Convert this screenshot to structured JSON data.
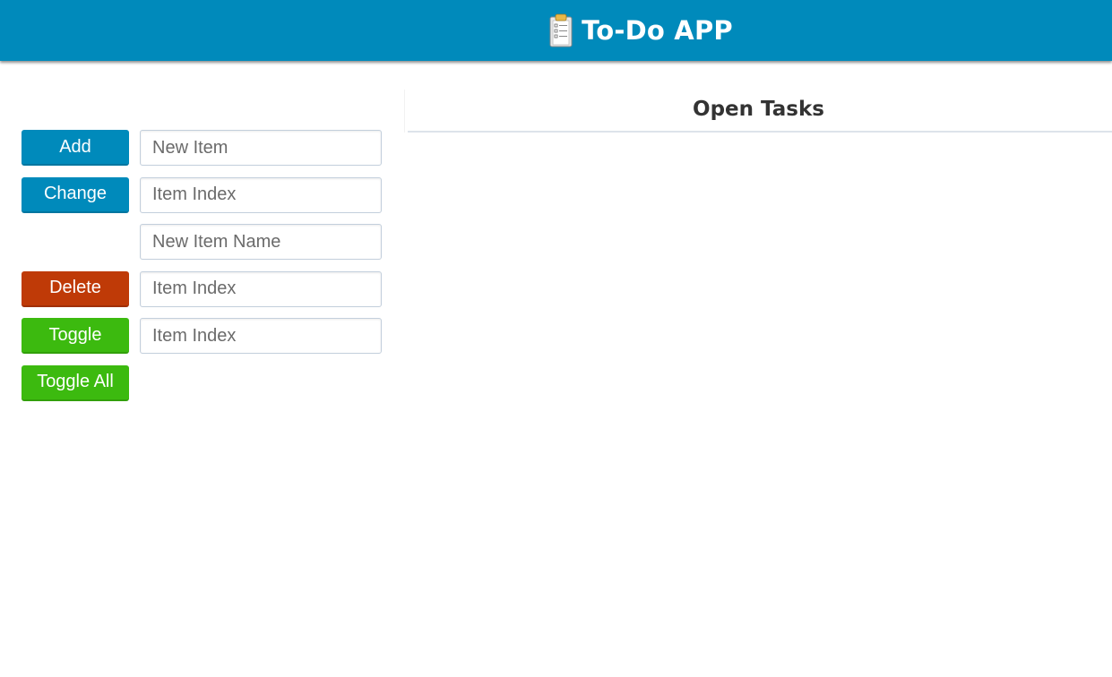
{
  "header": {
    "title": "To-Do APP",
    "icon": "clipboard-icon",
    "background_color": "#008abb"
  },
  "controls": {
    "add": {
      "button_label": "Add",
      "placeholder": "New Item"
    },
    "change": {
      "button_label": "Change",
      "index_placeholder": "Item Index",
      "name_placeholder": "New Item Name"
    },
    "delete": {
      "button_label": "Delete",
      "placeholder": "Item Index"
    },
    "toggle": {
      "button_label": "Toggle",
      "placeholder": "Item Index"
    },
    "toggle_all": {
      "button_label": "Toggle All"
    }
  },
  "tasks": {
    "title": "Open Tasks",
    "items": []
  },
  "colors": {
    "blue": "#008abb",
    "red": "#bf3a07",
    "green": "#3cba0f"
  }
}
